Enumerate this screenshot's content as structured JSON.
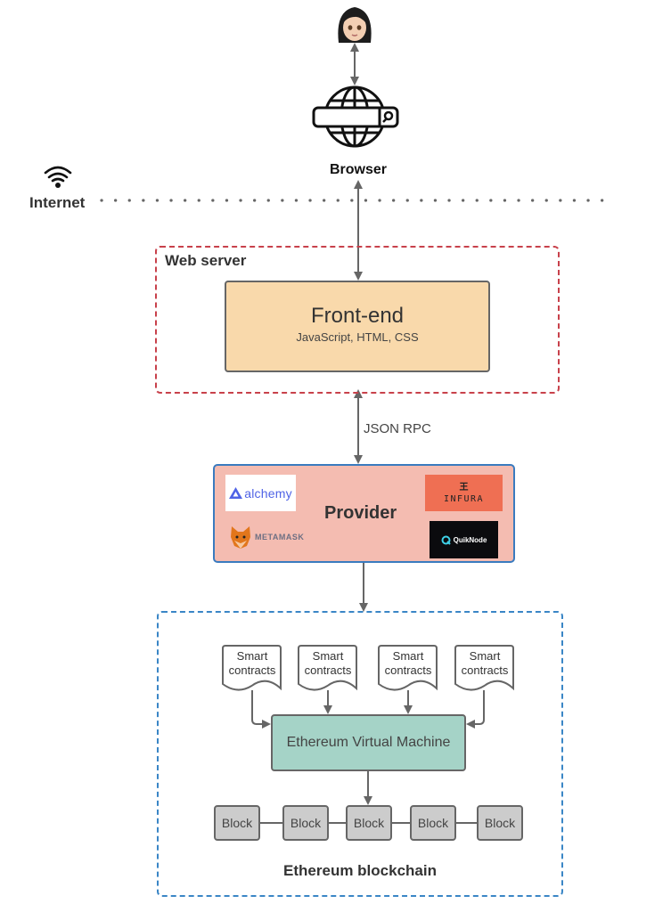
{
  "diagram": {
    "user": {
      "icon": "woman-emoji-icon",
      "glyph": "👩🏻"
    },
    "browser": {
      "label": "Browser",
      "icon": "globe-with-search-bar-icon"
    },
    "internet": {
      "label": "Internet",
      "icon": "wifi-icon"
    },
    "web_server": {
      "label": "Web server",
      "frontend": {
        "title": "Front-end",
        "subtitle": "JavaScript, HTML, CSS"
      }
    },
    "json_rpc_label": "JSON RPC",
    "provider": {
      "label": "Provider",
      "logos": {
        "alchemy": "alchemy",
        "metamask": "METAMASK",
        "infura_glyph": "王",
        "infura": "INFURA",
        "quiknode": "QuikNode"
      }
    },
    "blockchain": {
      "label": "Ethereum blockchain",
      "smart_contracts": [
        {
          "line1": "Smart",
          "line2": "contracts"
        },
        {
          "line1": "Smart",
          "line2": "contracts"
        },
        {
          "line1": "Smart",
          "line2": "contracts"
        },
        {
          "line1": "Smart",
          "line2": "contracts"
        }
      ],
      "evm": "Ethereum Virtual Machine",
      "blocks": [
        "Block",
        "Block",
        "Block",
        "Block",
        "Block"
      ]
    },
    "colors": {
      "web_server_border": "#c8414b",
      "frontend_fill": "#f9d9ab",
      "provider_fill": "#f4bcb1",
      "provider_border": "#3a7bbf",
      "blockchain_border": "#3a86c6",
      "evm_fill": "#a5d3c7",
      "block_fill": "#cccccc",
      "infura_fill": "#ef6f53",
      "quiknode_fill": "#0b0b0e",
      "alchemy_text": "#4f63e6"
    }
  }
}
